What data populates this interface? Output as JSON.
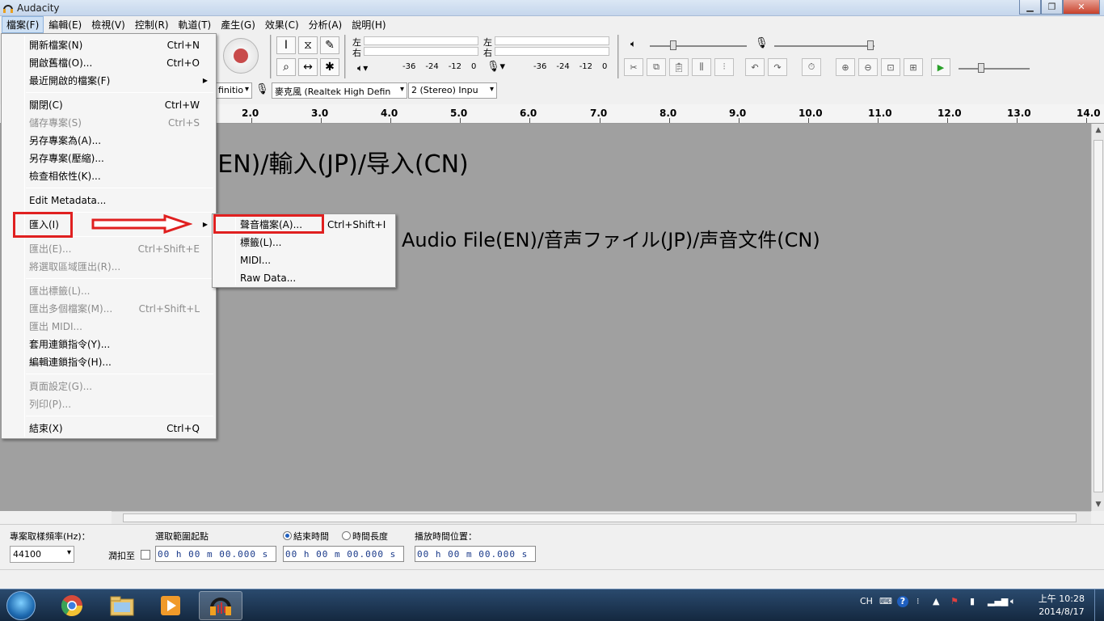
{
  "window": {
    "title": "Audacity",
    "minimize": "▁",
    "maximize": "❐",
    "close": "✕"
  },
  "menubar": [
    "檔案(F)",
    "編輯(E)",
    "檢視(V)",
    "控制(R)",
    "軌道(T)",
    "產生(G)",
    "效果(C)",
    "分析(A)",
    "說明(H)"
  ],
  "file_menu": {
    "items": [
      {
        "label": "開新檔案(N)",
        "shortcut": "Ctrl+N",
        "enabled": true
      },
      {
        "label": "開啟舊檔(O)...",
        "shortcut": "Ctrl+O",
        "enabled": true
      },
      {
        "label": "最近開啟的檔案(F)",
        "shortcut": "",
        "enabled": true,
        "submenu": true
      },
      {
        "label": "關閉(C)",
        "shortcut": "Ctrl+W",
        "enabled": true
      },
      {
        "label": "儲存專案(S)",
        "shortcut": "Ctrl+S",
        "enabled": false
      },
      {
        "label": "另存專案為(A)...",
        "shortcut": "",
        "enabled": true
      },
      {
        "label": "另存專案(壓縮)...",
        "shortcut": "",
        "enabled": true
      },
      {
        "label": "檢查相依性(K)...",
        "shortcut": "",
        "enabled": true
      },
      {
        "label": "Edit Metadata...",
        "shortcut": "",
        "enabled": true
      },
      {
        "label": "匯入(I)",
        "shortcut": "",
        "enabled": true,
        "submenu": true
      },
      {
        "label": "匯出(E)...",
        "shortcut": "Ctrl+Shift+E",
        "enabled": false
      },
      {
        "label": "將選取區域匯出(R)...",
        "shortcut": "",
        "enabled": false
      },
      {
        "label": "匯出標籤(L)...",
        "shortcut": "",
        "enabled": false
      },
      {
        "label": "匯出多個檔案(M)...",
        "shortcut": "Ctrl+Shift+L",
        "enabled": false
      },
      {
        "label": "匯出 MIDI...",
        "shortcut": "",
        "enabled": false
      },
      {
        "label": "套用連鎖指令(Y)...",
        "shortcut": "",
        "enabled": true
      },
      {
        "label": "編輯連鎖指令(H)...",
        "shortcut": "",
        "enabled": true
      },
      {
        "label": "頁面設定(G)...",
        "shortcut": "",
        "enabled": false
      },
      {
        "label": "列印(P)...",
        "shortcut": "",
        "enabled": false
      },
      {
        "label": "結束(X)",
        "shortcut": "Ctrl+Q",
        "enabled": true
      }
    ]
  },
  "import_submenu": {
    "items": [
      {
        "label": "聲音檔案(A)...",
        "shortcut": "Ctrl+Shift+I"
      },
      {
        "label": "標籤(L)...",
        "shortcut": ""
      },
      {
        "label": "MIDI...",
        "shortcut": ""
      },
      {
        "label": "Raw Data...",
        "shortcut": ""
      }
    ]
  },
  "annotations": {
    "import_caption": "Import(EN)/輸入(JP)/导入(CN)",
    "audio_file_caption": "Audio File(EN)/音声ファイル(JP)/声音文件(CN)"
  },
  "meters": {
    "play_left": "左",
    "play_right": "右",
    "rec_left": "左",
    "rec_right": "右",
    "ticks": [
      "-36",
      "-24",
      "-12",
      "0"
    ]
  },
  "device_toolbar": {
    "output_device": "finitio",
    "input_device": "麥克風 (Realtek High Defin",
    "channels": "2 (Stereo) Inpu"
  },
  "ruler": [
    "2.0",
    "3.0",
    "4.0",
    "5.0",
    "6.0",
    "7.0",
    "8.0",
    "9.0",
    "10.0",
    "11.0",
    "12.0",
    "13.0",
    "14.0"
  ],
  "selection_bar": {
    "rate_label": "專案取樣頻率(Hz)：",
    "rate_value": "44100",
    "snap_label": "潤扣至",
    "sel_start_label": "選取範圍起點",
    "end_label": "結束時間",
    "length_label": "時間長度",
    "playback_label": "播放時間位置：",
    "time_start": "00 h 00 m 00.000 s",
    "time_end": "00 h 00 m 00.000 s",
    "time_play": "00 h 00 m 00.000 s"
  },
  "taskbar": {
    "lang": "CH",
    "clock_time": "上午 10:28",
    "clock_date": "2014/8/17"
  },
  "colors": {
    "highlight_box": "#e02020",
    "accent": "#2060c0"
  }
}
